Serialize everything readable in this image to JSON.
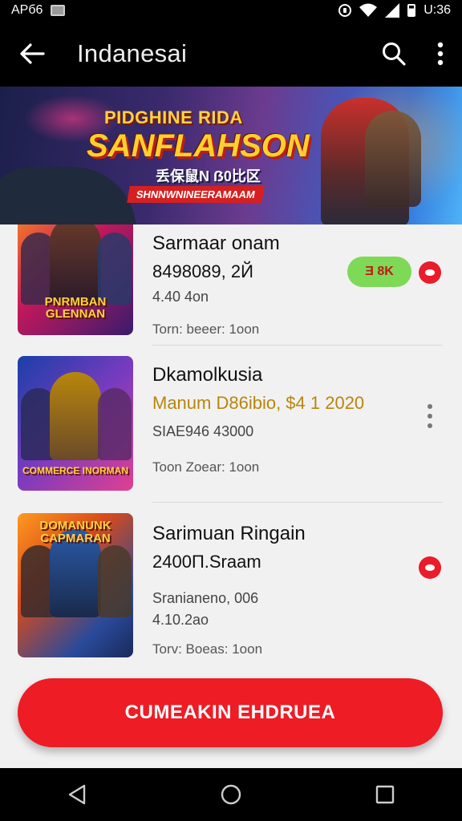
{
  "status_bar": {
    "carrier": "APб6",
    "time": "U:36"
  },
  "app_bar": {
    "title": "Indanesai"
  },
  "banner": {
    "line1": "PIDGHINE RIDA",
    "line2": "SANFLAHSON",
    "line3": "丢保鼠N ẞ0比区",
    "line4": "SHNNWNINEERAMAAM"
  },
  "items": [
    {
      "title": "Sarmaar onam",
      "line1": "8498089, 2Й",
      "line2": "4.40 4on",
      "meta": "Torn: beeer: 1oon",
      "thumb_label": "PNRMBAN GLENNAN",
      "badge": "Ǝ 8K"
    },
    {
      "title": "Dkamolkusia",
      "line1": "Manum D86ibio, $4 1 2020",
      "line2": "SIAE946 43000",
      "meta": "Toon Zoear: 1oon",
      "thumb_label": "COMMERCE INORMAN"
    },
    {
      "title": "Sarimuan Ringain",
      "line1": "2400П.Sraam",
      "line2": "Sranianeno, 006",
      "line3": "4.10.2ao",
      "meta": "Torv: Boeas: 1oon",
      "thumb_label": "DOMANUNK CAPMARAN"
    }
  ],
  "cta": {
    "label": "CUMEAKIN EHDRUEA"
  },
  "colors": {
    "accent": "#ee1c25",
    "badge_bg": "#7ed957",
    "gold": "#b8860b"
  }
}
